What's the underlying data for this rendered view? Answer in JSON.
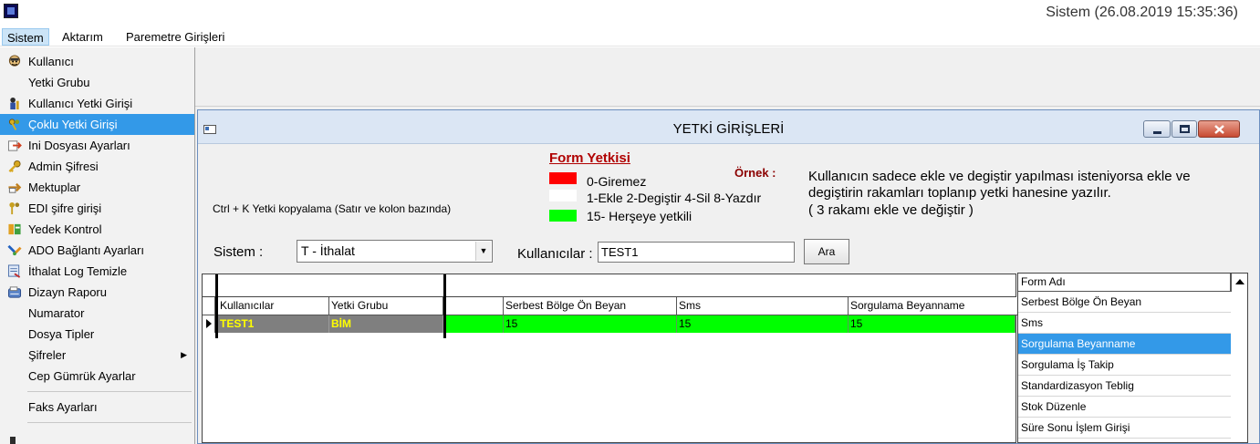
{
  "titlebar": {
    "status": "Sistem (26.08.2019 15:35:36)"
  },
  "menubar": {
    "items": [
      "Sistem",
      "Aktarım",
      "Paremetre Girişleri"
    ]
  },
  "dropdown": {
    "items": [
      {
        "label": "Kullanıcı",
        "icon": "user-face-icon"
      },
      {
        "label": "Yetki Grubu",
        "icon": ""
      },
      {
        "label": "Kullanıcı Yetki Girişi",
        "icon": "user-key-icon"
      },
      {
        "label": "Çoklu Yetki Girişi",
        "icon": "multi-key-icon",
        "selected": true
      },
      {
        "label": "Ini Dosyası Ayarları",
        "icon": "file-arrow-icon"
      },
      {
        "label": "Admin Şifresi",
        "icon": "key-icon"
      },
      {
        "label": "Mektuplar",
        "icon": "letter-arrow-icon"
      },
      {
        "label": "EDI şifre girişi",
        "icon": "keys-icon"
      },
      {
        "label": "Yedek Kontrol",
        "icon": "backup-icon"
      },
      {
        "label": "ADO Bağlantı Ayarları",
        "icon": "connection-icon"
      },
      {
        "label": "İthalat Log Temizle",
        "icon": "log-clean-icon"
      },
      {
        "label": "Dizayn Raporu",
        "icon": "report-icon"
      },
      {
        "label": "Numarator",
        "icon": ""
      },
      {
        "label": "Dosya Tipler",
        "icon": ""
      },
      {
        "label": "Şifreler",
        "icon": "",
        "submenu": true
      },
      {
        "label": "Cep Gümrük Ayarlar",
        "icon": ""
      },
      {
        "label": "Faks Ayarları",
        "icon": ""
      }
    ]
  },
  "window": {
    "title": "YETKİ GİRİŞLERİ",
    "ctrl_copy_hint": "Ctrl + K Yetki kopyalama (Satır ve kolon bazında)",
    "form_yetkisi": {
      "title": "Form Yetkisi",
      "legend": [
        {
          "label": "0-Giremez",
          "color": "#ff0000"
        },
        {
          "label": "1-Ekle  2-Degiştir  4-Sil  8-Yazdır",
          "color": "#ffffff"
        },
        {
          "label": "15- Herşeye yetkili",
          "color": "#00ff00"
        }
      ]
    },
    "ornek": {
      "label": "Örnek :",
      "lines": [
        "Kullanıcın sadece ekle ve degiştir yapılması isteniyorsa  ekle ve",
        "degiştirin rakamları toplanıp yetki hanesine yazılır.",
        " ( 3 rakamı ekle ve değiştir )"
      ]
    },
    "sistem_label": "Sistem :",
    "sistem_value": "T - İthalat",
    "kullanicilar_label": "Kullanıcılar :",
    "kullanicilar_value": "TEST1",
    "ara_label": "Ara",
    "grid": {
      "columns": [
        "Kullanıcılar",
        "Yetki Grubu",
        "Serbest Bölge Ön Beyan",
        "Sms",
        "Sorgulama Beyanname"
      ],
      "rows": [
        {
          "kullanici": "TEST1",
          "yetki_grubu": "BİM",
          "values": [
            "15",
            "15",
            "15"
          ]
        }
      ]
    },
    "form_list": {
      "header": "Form Adı",
      "items": [
        {
          "label": "Serbest Bölge Ön Beyan"
        },
        {
          "label": "Sms"
        },
        {
          "label": "Sorgulama Beyanname",
          "selected": true
        },
        {
          "label": "Sorgulama İş Takip"
        },
        {
          "label": "Standardizasyon Teblig"
        },
        {
          "label": "Stok Düzenle"
        },
        {
          "label": "Süre Sonu İşlem Girişi"
        }
      ]
    }
  }
}
